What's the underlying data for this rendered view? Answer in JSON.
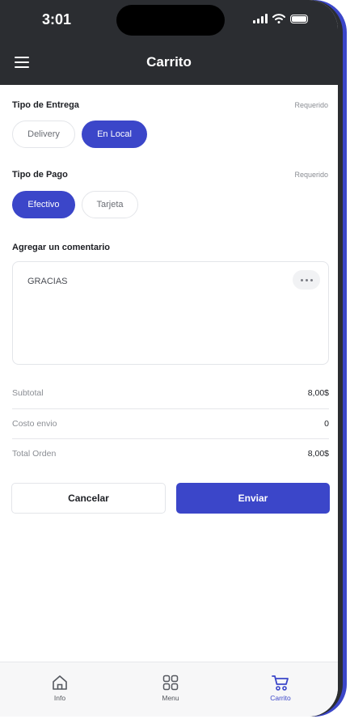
{
  "status": {
    "time": "3:01"
  },
  "appbar": {
    "title": "Carrito"
  },
  "delivery": {
    "title": "Tipo de Entrega",
    "required": "Requerido",
    "options": [
      "Delivery",
      "En Local"
    ],
    "selected": "En Local"
  },
  "payment": {
    "title": "Tipo de Pago",
    "required": "Requerido",
    "options": [
      "Efectivo",
      "Tarjeta"
    ],
    "selected": "Efectivo"
  },
  "comment": {
    "label": "Agregar un comentario",
    "value": "GRACIAS"
  },
  "summary": [
    {
      "label": "Subtotal",
      "value": "8,00$"
    },
    {
      "label": "Costo envio",
      "value": "0"
    },
    {
      "label": "Total Orden",
      "value": "8,00$"
    }
  ],
  "actions": {
    "cancel": "Cancelar",
    "send": "Enviar"
  },
  "tabs": [
    {
      "label": "Info",
      "icon": "home-icon"
    },
    {
      "label": "Menu",
      "icon": "grid-icon"
    },
    {
      "label": "Carrito",
      "icon": "cart-icon",
      "active": true
    }
  ],
  "colors": {
    "accent": "#3b46c9",
    "header": "#2b2d31"
  }
}
